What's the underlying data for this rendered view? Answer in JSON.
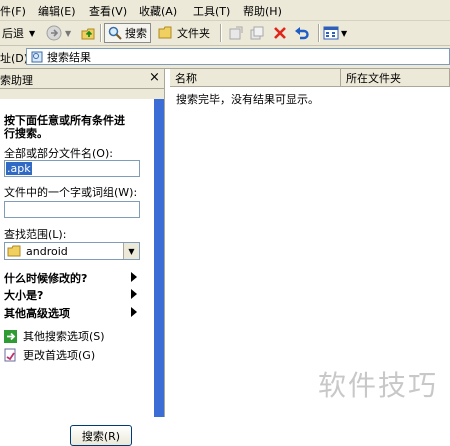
{
  "menu": [
    "件(F)",
    "编辑(E)",
    "查看(V)",
    "收藏(A)",
    "工具(T)",
    "帮助(H)"
  ],
  "toolbar": {
    "back": "后退",
    "search": "搜索",
    "folders": "文件夹"
  },
  "address": {
    "label": "址(D)",
    "value": "搜索结果"
  },
  "search_pane": {
    "title": "索助理",
    "close": "×",
    "heading_line1": "按下面任意或所有条件进",
    "heading_line2": "行搜索。",
    "filename_label": "全部或部分文件名(O):",
    "filename_value": ".apk",
    "word_label": "文件中的一个字或词组(W):",
    "word_value": "",
    "lookin_label": "查找范围(L):",
    "lookin_value": "android",
    "when_modified": "什么时候修改的?",
    "size": "大小是?",
    "advanced": "其他高级选项",
    "other_options": "其他搜索选项(S)",
    "change_prefs": "更改首选项(G)",
    "search_button": "搜索(R)"
  },
  "results": {
    "col_name": "名称",
    "col_folder": "所在文件夹",
    "message": "搜索完毕，没有结果可显示。"
  },
  "watermark": "软件技巧"
}
